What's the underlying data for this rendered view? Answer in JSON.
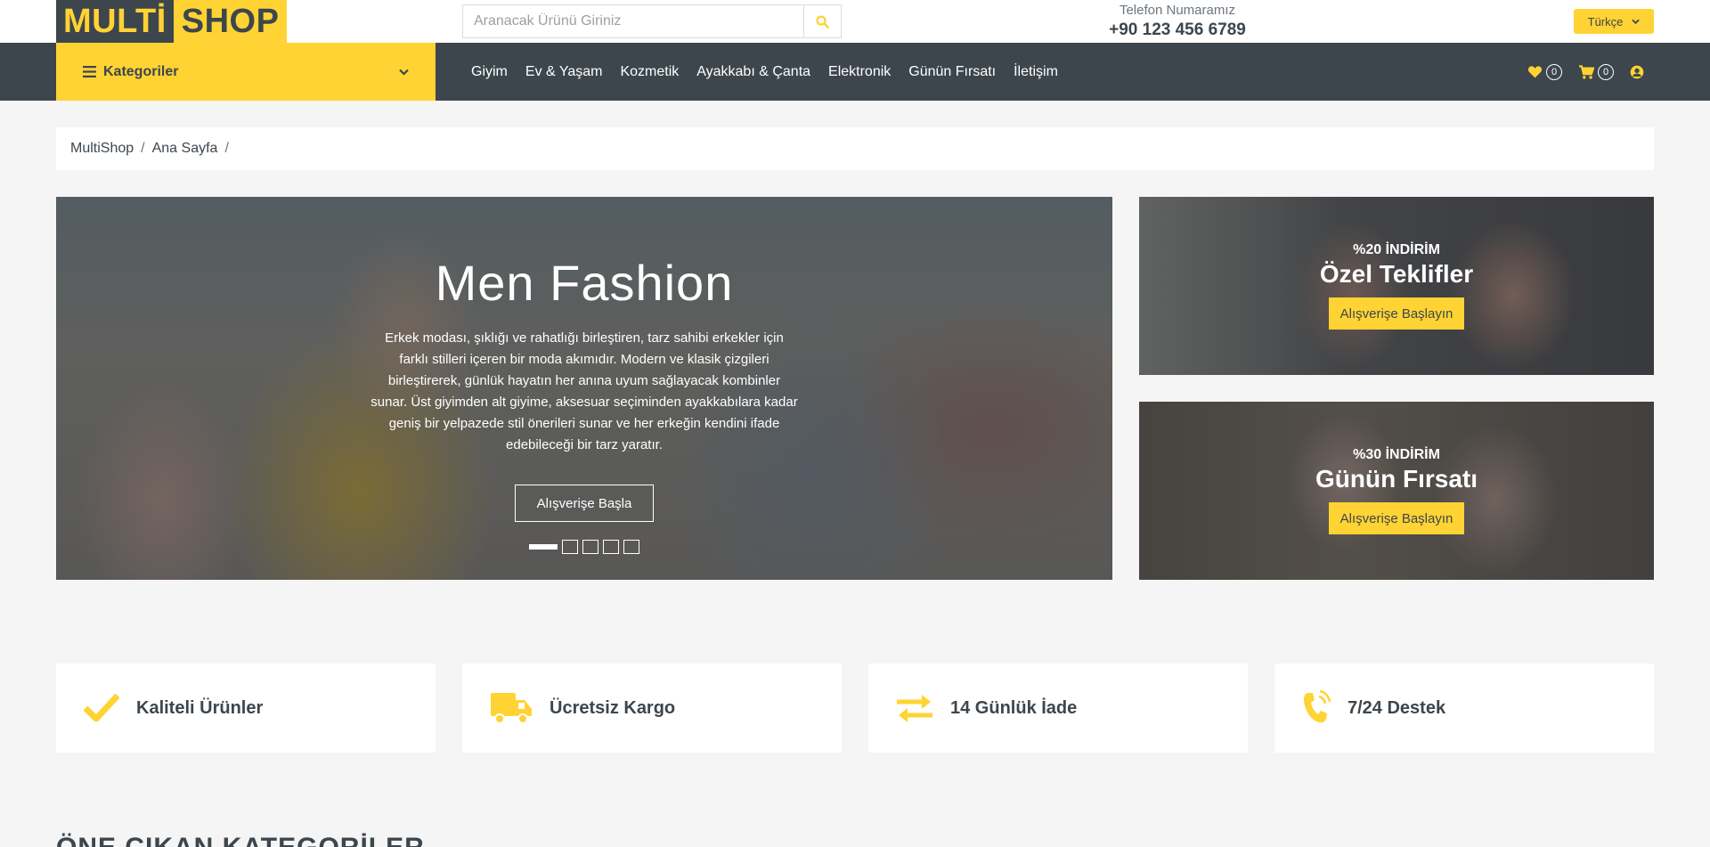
{
  "header": {
    "logo_part1": "MULTİ",
    "logo_part2": "SHOP",
    "search_placeholder": "Aranacak Ürünü Giriniz",
    "phone_label": "Telefon Numaramız",
    "phone_number": "+90 123 456 6789",
    "language": "Türkçe"
  },
  "nav": {
    "categories_label": "Kategoriler",
    "items": [
      "Giyim",
      "Ev & Yaşam",
      "Kozmetik",
      "Ayakkabı & Çanta",
      "Elektronik",
      "Günün Fırsatı",
      "İletişim"
    ],
    "wishlist_count": "0",
    "cart_count": "0"
  },
  "breadcrumb": [
    "MultiShop",
    "Ana Sayfa"
  ],
  "hero": {
    "title": "Men Fashion",
    "text": "Erkek modası, şıklığı ve rahatlığı birleştiren, tarz sahibi erkekler için farklı stilleri içeren bir moda akımıdır. Modern ve klasik çizgileri birleştirerek, günlük hayatın her anına uyum sağlayacak kombinler sunar. Üst giyimden alt giyime, aksesuar seçiminden ayakkabılara kadar geniş bir yelpazede stil önerileri sunar ve her erkeğin kendini ifade edebileceği bir tarz yaratır.",
    "button": "Alışverişe Başla",
    "slide_count": 5,
    "active_slide": 1
  },
  "offers": [
    {
      "discount": "%20 İNDİRİM",
      "title": "Özel Teklifler",
      "button": "Alışverişe Başlayın"
    },
    {
      "discount": "%30 İNDİRİM",
      "title": "Günün Fırsatı",
      "button": "Alışverişe Başlayın"
    }
  ],
  "features": [
    {
      "icon": "check-icon",
      "label": "Kaliteli Ürünler"
    },
    {
      "icon": "truck-icon",
      "label": "Ücretsiz Kargo"
    },
    {
      "icon": "exchange-icon",
      "label": "14 Günlük İade"
    },
    {
      "icon": "phone-volume-icon",
      "label": "7/24 Destek"
    }
  ],
  "section_title": "ÖNE ÇIKAN KATEGORİLER",
  "colors": {
    "accent": "#ffd333",
    "dark": "#3d464d",
    "background": "#f5f5f5"
  }
}
